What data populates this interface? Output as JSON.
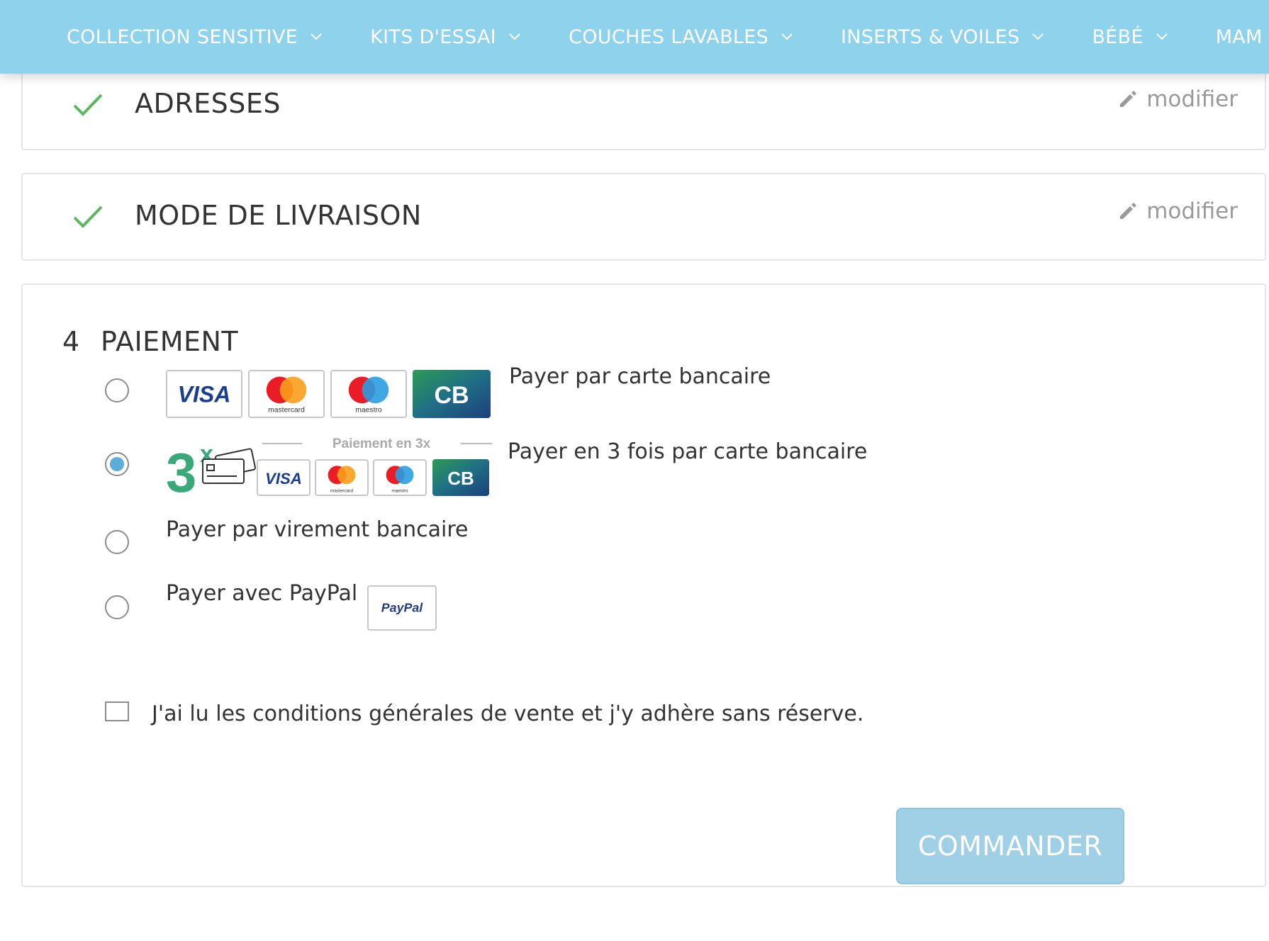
{
  "nav": {
    "items": [
      {
        "label": "COLLECTION SENSITIVE"
      },
      {
        "label": "KITS D'ESSAI"
      },
      {
        "label": "COUCHES LAVABLES"
      },
      {
        "label": "INSERTS & VOILES"
      },
      {
        "label": "BÉBÉ"
      },
      {
        "label": "MAM"
      }
    ]
  },
  "steps": {
    "addresses": {
      "title": "ADRESSES",
      "modify_label": "modifier",
      "status_icon": "check-icon"
    },
    "delivery": {
      "title": "MODE DE LIVRAISON",
      "modify_label": "modifier",
      "status_icon": "check-icon"
    },
    "payment": {
      "number": "4",
      "title": "PAIEMENT",
      "options": [
        {
          "label": "Payer par carte bancaire",
          "selected": false,
          "logos": [
            "VISA",
            "mastercard",
            "maestro",
            "CB"
          ]
        },
        {
          "label": "Payer en 3 fois par carte bancaire",
          "selected": true,
          "badge_main": "3",
          "badge_sup": "x",
          "badge_caption": "Paiement en 3x",
          "logos": [
            "VISA",
            "mastercard",
            "maestro",
            "CB"
          ]
        },
        {
          "label": "Payer par virement bancaire",
          "selected": false
        },
        {
          "label": "Payer avec PayPal",
          "selected": false,
          "logo": "PayPal"
        }
      ],
      "terms_label": "J'ai lu les conditions générales de vente et j'y adhère sans réserve.",
      "terms_checked": false,
      "submit_label": "COMMANDER"
    }
  },
  "colors": {
    "nav_bg": "#8fd2ec",
    "check": "#5cb85c",
    "radio_selected": "#5aaed8",
    "button_bg": "#9fd0e6",
    "three_x_green": "#3aa97a"
  }
}
